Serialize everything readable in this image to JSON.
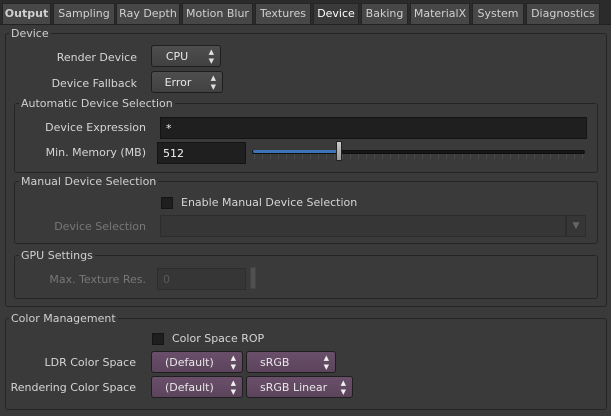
{
  "tabs": [
    {
      "label": "Output"
    },
    {
      "label": "Sampling"
    },
    {
      "label": "Ray Depth"
    },
    {
      "label": "Motion Blur"
    },
    {
      "label": "Textures"
    },
    {
      "label": "Device"
    },
    {
      "label": "Baking"
    },
    {
      "label": "MaterialX"
    },
    {
      "label": "System"
    },
    {
      "label": "Diagnostics"
    }
  ],
  "active_tab": "Device",
  "device": {
    "title": "Device",
    "render_device": {
      "label": "Render Device",
      "value": "CPU"
    },
    "device_fallback": {
      "label": "Device Fallback",
      "value": "Error"
    },
    "automatic": {
      "title": "Automatic Device Selection",
      "expression_label": "Device Expression",
      "expression_value": "*",
      "min_memory_label": "Min. Memory (MB)",
      "min_memory_value": "512",
      "min_memory_slider_fraction": 0.26
    },
    "manual": {
      "title": "Manual Device Selection",
      "enable_label": "Enable Manual Device Selection",
      "enable_checked": false,
      "selection_label": "Device Selection",
      "selection_value": ""
    },
    "gpu": {
      "title": "GPU Settings",
      "max_texture_label": "Max. Texture Res.",
      "max_texture_value": "0"
    }
  },
  "color_management": {
    "title": "Color Management",
    "rop_label": "Color Space ROP",
    "rop_checked": false,
    "ldr": {
      "label": "LDR Color Space",
      "role": "(Default)",
      "space": "sRGB"
    },
    "rendering": {
      "label": "Rendering Color Space",
      "role": "(Default)",
      "space": "sRGB Linear"
    }
  },
  "colors": {
    "accent_slider": "#3d74b8",
    "colorspace_menu": "#5c445c",
    "background": "#3a3a3a"
  },
  "icons": {
    "menu_arrows": "up-down-arrows-icon",
    "dropdown": "chevron-down-icon"
  }
}
